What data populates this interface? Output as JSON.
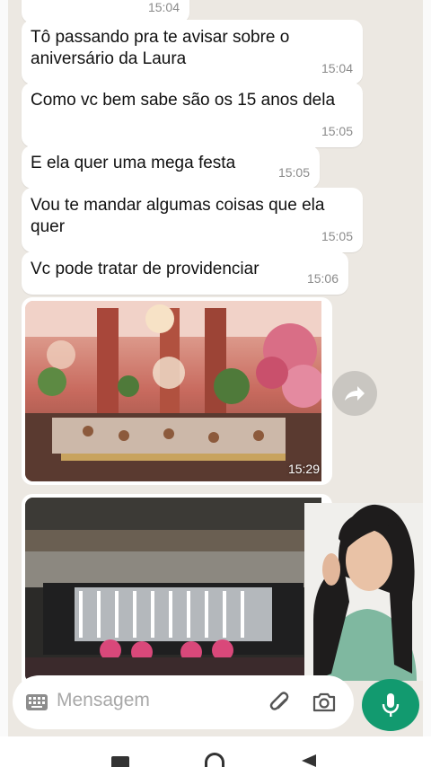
{
  "messages": [
    {
      "text": "Tô passando pra te avisar sobre o aniversário da Laura",
      "time": "15:04"
    },
    {
      "text": "Como vc bem sabe são os 15 anos dela",
      "time": "15:05"
    },
    {
      "text": "E ela quer uma mega festa",
      "time": "15:05"
    },
    {
      "text": "Vou te mandar algumas coisas que ela quer",
      "time": "15:05"
    },
    {
      "text": "Vc pode tratar de providenciar",
      "time": "15:06"
    }
  ],
  "partial_top_time": "15:04",
  "images": [
    {
      "icon": "party-hall-photo",
      "time": "15:29"
    },
    {
      "icon": "stage-decoration-photo"
    }
  ],
  "input": {
    "placeholder": "Mensagem"
  },
  "icons": {
    "keyboard": "keyboard-icon",
    "attach": "paperclip-icon",
    "camera": "camera-icon",
    "mic": "microphone-icon",
    "forward": "forward-icon"
  },
  "colors": {
    "chat_bg": "#ece8e2",
    "accent": "#129a6f",
    "bubble": "#ffffff"
  }
}
